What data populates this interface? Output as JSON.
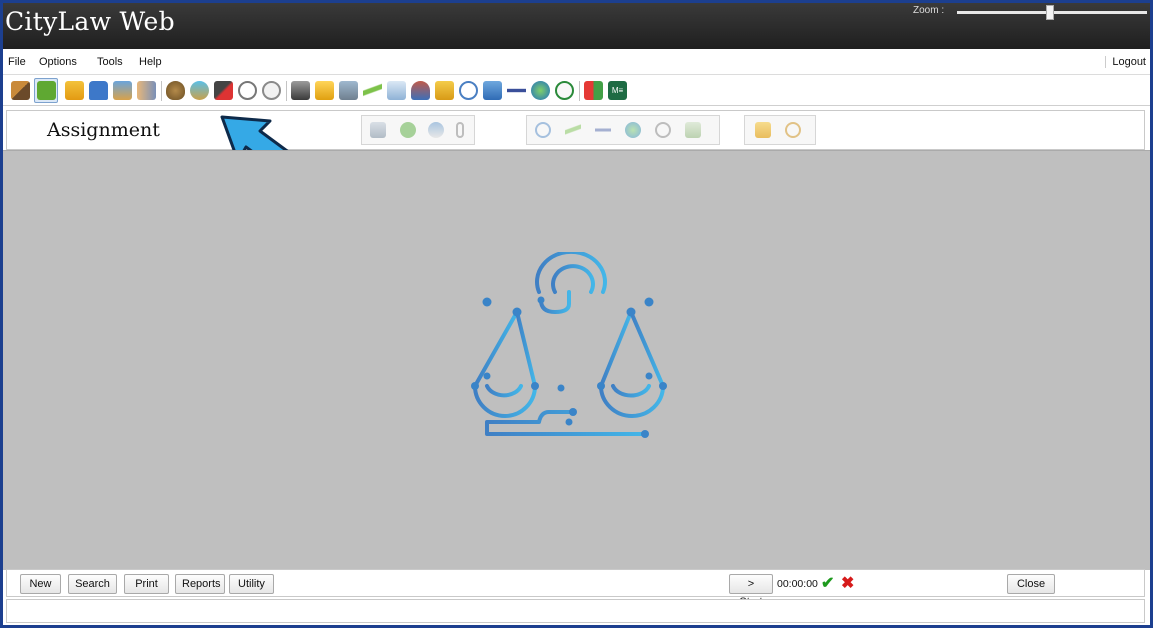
{
  "app": {
    "title": "CityLaw Web",
    "zoom_label": "Zoom :"
  },
  "menu": {
    "items": [
      "File",
      "Options",
      "Tools",
      "Help"
    ],
    "logout": "Logout"
  },
  "toolbar": {
    "icons": [
      "gavel-icon",
      "green-book-icon",
      "folder-open-icon",
      "lock-icon",
      "scanner-icon",
      "handshake-icon",
      "money-bag-icon",
      "diamond-ring-icon",
      "tools-icon",
      "stopwatch-icon",
      "clock-icon",
      "printer-icon",
      "envelope-icon",
      "ledger-icon",
      "ruler-icon",
      "tag-icon",
      "person-run-icon",
      "clipboard-icon",
      "magnifier-icon",
      "calendar-icon",
      "airplane-icon",
      "globe-icon",
      "refresh-icon",
      "window-grid-icon",
      "ms-excel-icon"
    ],
    "ms_label": "M≡"
  },
  "module": {
    "title": "Assignment",
    "group1_icons": [
      "table-icon",
      "dollar-icon",
      "paint-icon",
      "paperclip-icon"
    ],
    "group2_icons": [
      "magnifier-icon",
      "ruler-icon",
      "airplane-icon",
      "globe-icon",
      "stopwatch-icon",
      "image-icon"
    ],
    "group3_icons": [
      "folder-icon",
      "zoom-icon"
    ]
  },
  "bottom": {
    "new": "New",
    "search": "Search",
    "print": "Print",
    "reports": "Reports",
    "utility": "Utility",
    "start": "> Start",
    "timer": "00:00:00",
    "close": "Close"
  }
}
